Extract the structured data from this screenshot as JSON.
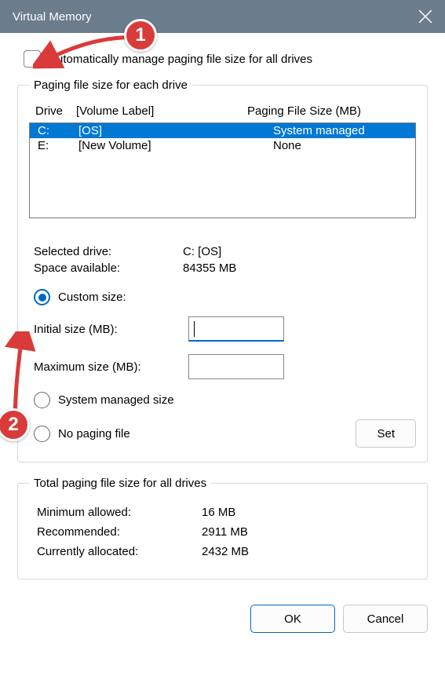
{
  "title": "Virtual Memory",
  "auto_manage_label": "Automatically manage paging file size for all drives",
  "auto_manage_checked": false,
  "fieldset1_legend": "Paging file size for each drive",
  "drive_header": {
    "drive": "Drive",
    "volume": "[Volume Label]",
    "size": "Paging File Size (MB)"
  },
  "drives": [
    {
      "drive": "C:",
      "volume": "[OS]",
      "size": "System managed",
      "selected": true
    },
    {
      "drive": "E:",
      "volume": "[New Volume]",
      "size": "None",
      "selected": false
    }
  ],
  "selected_drive": {
    "label": "Selected drive:",
    "value": "C:  [OS]"
  },
  "space_available": {
    "label": "Space available:",
    "value": "84355 MB"
  },
  "radio": {
    "custom": "Custom size:",
    "system": "System managed size",
    "none": "No paging file",
    "selected": "custom"
  },
  "initial_size_label": "Initial size (MB):",
  "maximum_size_label": "Maximum size (MB):",
  "initial_size_value": "",
  "maximum_size_value": "",
  "set_button": "Set",
  "fieldset2_legend": "Total paging file size for all drives",
  "minimum": {
    "label": "Minimum allowed:",
    "value": "16 MB"
  },
  "recommended": {
    "label": "Recommended:",
    "value": "2911 MB"
  },
  "allocated": {
    "label": "Currently allocated:",
    "value": "2432 MB"
  },
  "ok_button": "OK",
  "cancel_button": "Cancel",
  "annotations": {
    "step1": "1",
    "step2": "2"
  }
}
